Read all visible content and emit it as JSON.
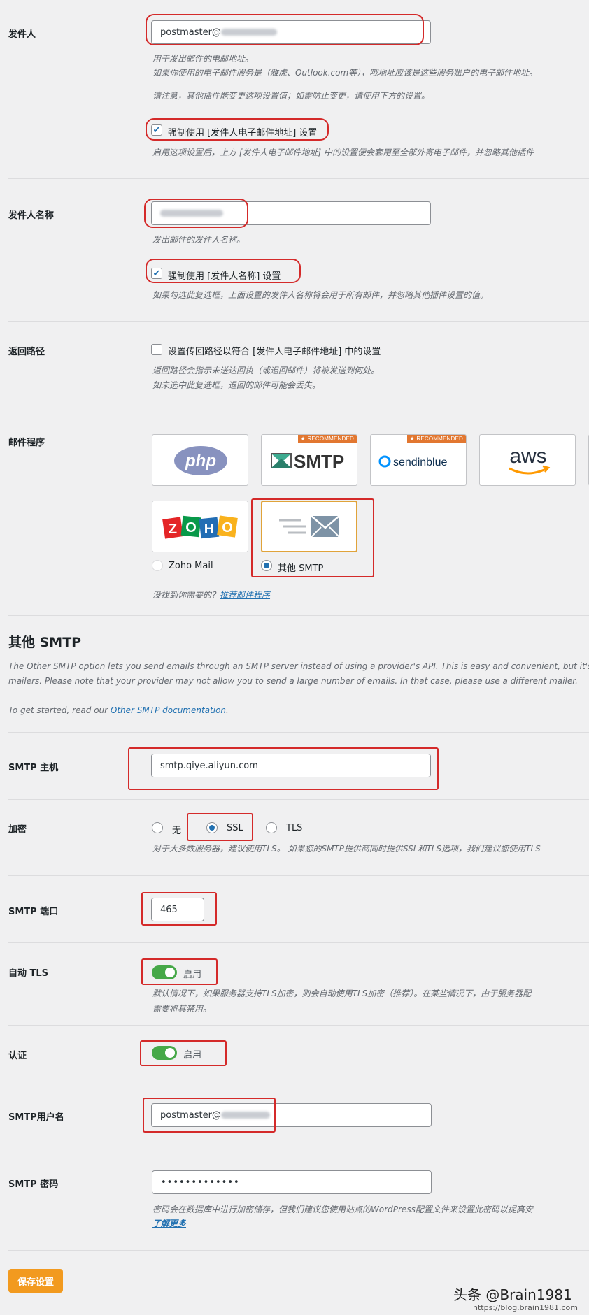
{
  "from_email": {
    "label": "发件人",
    "value_prefix": "postmaster@",
    "desc_1": "用于发出邮件的电邮地址。",
    "desc_2": "如果你使用的电子邮件服务是（雅虎、Outlook.com等），哦地址应该是这些服务账户的电子邮件地址。",
    "desc_3": "请注意，其他插件能变更这项设置值；如需防止变更，请使用下方的设置。",
    "force_label": "强制使用 [发件人电子邮件地址] 设置",
    "force_desc": "启用这项设置后，上方 [发件人电子邮件地址] 中的设置便会套用至全部外寄电子邮件，并忽略其他插件"
  },
  "from_name": {
    "label": "发件人名称",
    "desc": "发出邮件的发件人名称。",
    "force_label": "强制使用 [发件人名称] 设置",
    "force_desc": "如果勾选此复选框，上面设置的发件人名称将会用于所有邮件，并忽略其他插件设置的值。"
  },
  "return_path": {
    "label": "返回路径",
    "check_label": "设置传回路径以符合 [发件人电子邮件地址] 中的设置",
    "desc_1": "返回路径会指示未送达回执（或退回邮件）将被发送到何处。",
    "desc_2": "如未选中此复选框，退回的邮件可能会丢失。"
  },
  "mailer": {
    "label": "邮件程序",
    "tiles": [
      {
        "logo": "php"
      },
      {
        "logo": "SMTP",
        "badge": "RECOMMENDED"
      },
      {
        "logo": "sendinblue",
        "badge": "RECOMMENDED"
      },
      {
        "logo": "aws"
      },
      {
        "logo": "ZOHO",
        "radio_label": "Zoho Mail"
      },
      {
        "logo": "other-smtp",
        "radio_label": "其他 SMTP"
      }
    ],
    "suggest_text": "没找到你需要的？",
    "suggest_link": "推荐邮件程序"
  },
  "other_smtp": {
    "heading": "其他 SMTP",
    "intro_1": "The Other SMTP option lets you send emails through an SMTP server instead of using a provider's API. This is easy and convenient, but it's",
    "intro_2": "mailers. Please note that your provider may not allow you to send a large number of emails. In that case, please use a different mailer.",
    "start_text": "To get started, read our ",
    "start_link": "Other SMTP documentation",
    "start_end": "."
  },
  "smtp_host": {
    "label": "SMTP 主机",
    "value": "smtp.qiye.aliyun.com"
  },
  "encryption": {
    "label": "加密",
    "options": [
      "无",
      "SSL",
      "TLS"
    ],
    "selected": "SSL",
    "desc": "对于大多数服务器，建议使用TLS。 如果您的SMTP提供商同时提供SSL和TLS选项，我们建议您使用TLS"
  },
  "smtp_port": {
    "label": "SMTP 端口",
    "value": "465"
  },
  "auto_tls": {
    "label": "自动 TLS",
    "toggle_label": "启用",
    "desc_1": "默认情况下，如果服务器支持TLS加密，则会自动使用TLS加密（推荐）。在某些情况下，由于服务器配",
    "desc_2": "需要将其禁用。"
  },
  "auth": {
    "label": "认证",
    "toggle_label": "启用"
  },
  "smtp_user": {
    "label": "SMTP用户名",
    "value_prefix": "postmaster@"
  },
  "smtp_pass": {
    "label": "SMTP 密码",
    "value": "•••••••••••••",
    "desc": "密码会在数据库中进行加密储存，但我们建议您使用站点的WordPress配置文件来设置此密码以提高安",
    "learn_more": "了解更多"
  },
  "save_button": "保存设置",
  "watermark": {
    "text": "头条 @Brain1981",
    "url": "https://blog.brain1981.com"
  },
  "colors": {
    "accent": "#2271b1",
    "highlight": "#d42a2a",
    "button": "#f29a1f",
    "toggle": "#46a848"
  }
}
